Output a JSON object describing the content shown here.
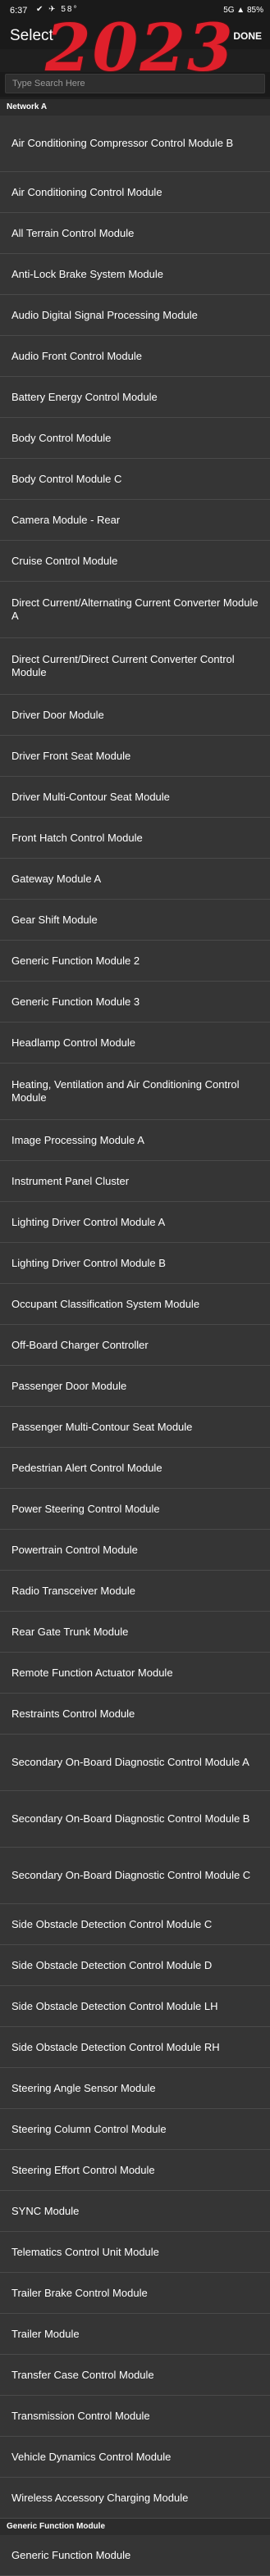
{
  "status_bar": {
    "time": "6:37",
    "icons_left": "✔ ✈ 58°",
    "right": "5G ▲ 85%"
  },
  "header": {
    "title": "Select",
    "done_label": "DONE",
    "overlay_year": "2023"
  },
  "search": {
    "placeholder": "Type Search Here"
  },
  "sections": [
    {
      "title": "Network A",
      "items": [
        "Air Conditioning Compressor Control Module B",
        "Air Conditioning Control Module",
        "All Terrain Control Module",
        "Anti-Lock Brake System Module",
        "Audio Digital Signal Processing Module",
        "Audio Front Control Module",
        "Battery Energy Control Module",
        "Body Control Module",
        "Body Control Module C",
        "Camera Module - Rear",
        "Cruise Control Module",
        "Direct Current/Alternating Current Converter Module A",
        "Direct Current/Direct Current Converter Control Module",
        "Driver Door Module",
        "Driver Front Seat Module",
        "Driver Multi-Contour Seat Module",
        "Front Hatch Control Module",
        "Gateway Module A",
        "Gear Shift Module",
        "Generic Function Module 2",
        "Generic Function Module 3",
        "Headlamp Control Module",
        "Heating, Ventilation and Air Conditioning Control Module",
        "Image Processing Module A",
        "Instrument Panel Cluster",
        "Lighting Driver Control Module A",
        "Lighting Driver Control Module B",
        "Occupant Classification System Module",
        "Off-Board Charger Controller",
        "Passenger Door Module",
        "Passenger Multi-Contour Seat Module",
        "Pedestrian Alert Control Module",
        "Power Steering Control Module",
        "Powertrain Control Module",
        "Radio Transceiver Module",
        "Rear Gate Trunk Module",
        "Remote Function Actuator Module",
        "Restraints Control Module",
        "Secondary On-Board Diagnostic Control Module A",
        "Secondary On-Board Diagnostic Control Module B",
        "Secondary On-Board Diagnostic Control Module C",
        "Side Obstacle Detection Control Module C",
        "Side Obstacle Detection Control Module D",
        "Side Obstacle Detection Control Module LH",
        "Side Obstacle Detection Control Module RH",
        "Steering Angle Sensor Module",
        "Steering Column Control Module",
        "Steering Effort Control Module",
        "SYNC Module",
        "Telematics Control Unit Module",
        "Trailer Brake Control Module",
        "Trailer Module",
        "Transfer Case Control Module",
        "Transmission Control Module",
        "Vehicle Dynamics Control Module",
        "Wireless Accessory Charging Module"
      ]
    },
    {
      "title": "Generic Function Module",
      "items": [
        "Generic Function Module"
      ]
    }
  ]
}
